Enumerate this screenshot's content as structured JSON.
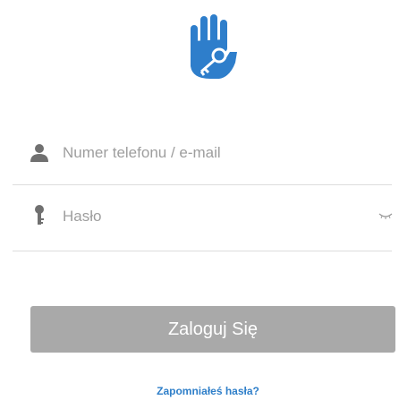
{
  "logo": {
    "icon": "hand-with-key-icon",
    "color": "#2e7ecb"
  },
  "login_form": {
    "phone_email": {
      "icon": "user-icon",
      "placeholder": "Numer telefonu / e-mail",
      "value": ""
    },
    "password": {
      "icon": "key-icon",
      "placeholder": "Hasło",
      "value": "",
      "toggle_icon": "eye-closed-icon"
    },
    "submit_label": "Zaloguj Się",
    "forgot_password_label": "Zapomniałeś hasła?"
  },
  "colors": {
    "accent": "#2f7fc9",
    "button_disabled": "#a9a9a9",
    "icon_gray": "#707070",
    "placeholder": "#9e9e9e",
    "divider": "#dddddd"
  }
}
